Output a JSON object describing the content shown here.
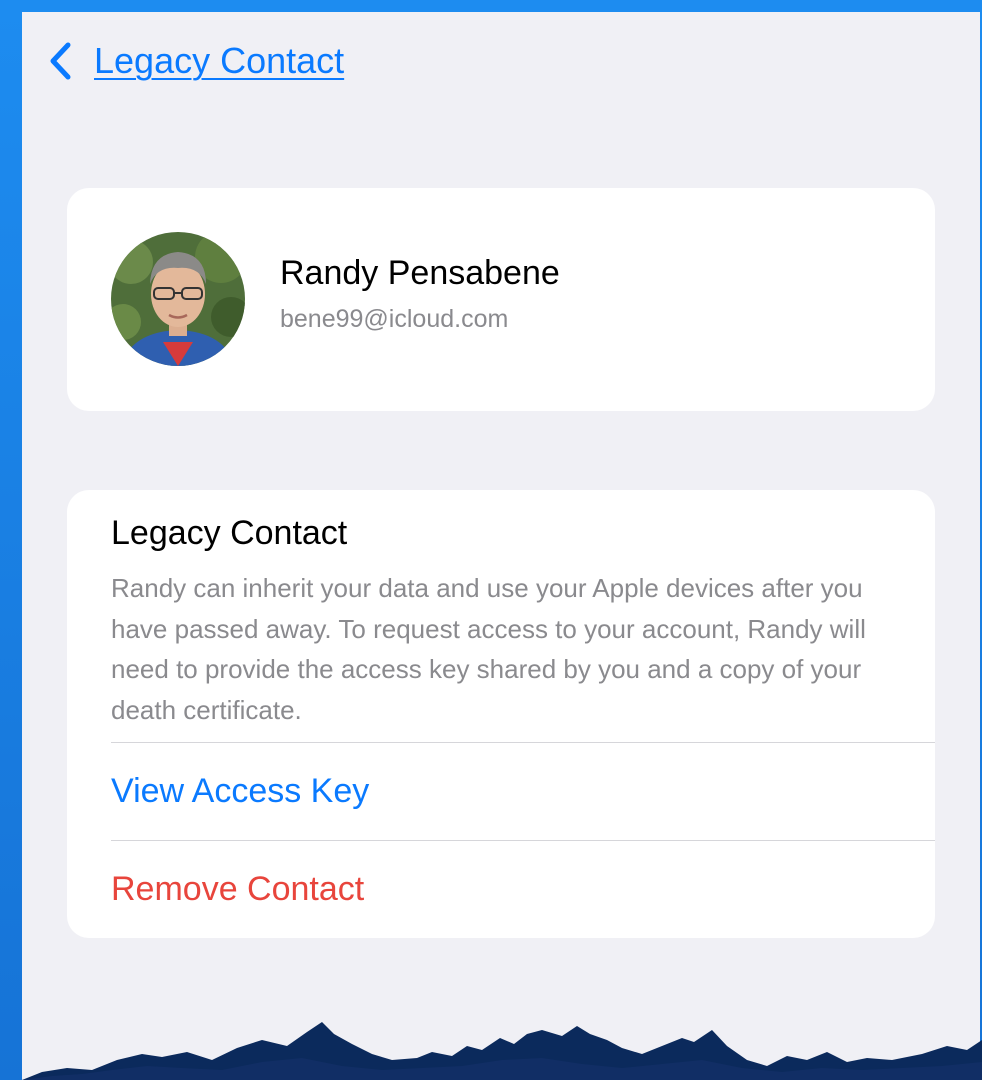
{
  "nav": {
    "back_icon": "chevron-left-icon",
    "title": "Legacy Contact"
  },
  "profile": {
    "name": "Randy Pensabene",
    "email": "bene99@icloud.com",
    "avatar": "avatar-photo"
  },
  "info": {
    "title": "Legacy Contact",
    "description": "Randy can inherit your data and use your Apple devices after you have passed away. To request access to your account, Randy will need to provide the access key shared by you and a copy of your death certificate."
  },
  "actions": {
    "view_access_key": "View Access Key",
    "remove_contact": "Remove Contact"
  },
  "colors": {
    "accent": "#0a7aff",
    "destructive": "#e8453c",
    "background": "#f0f0f5",
    "frame": "#1d8cf0"
  }
}
